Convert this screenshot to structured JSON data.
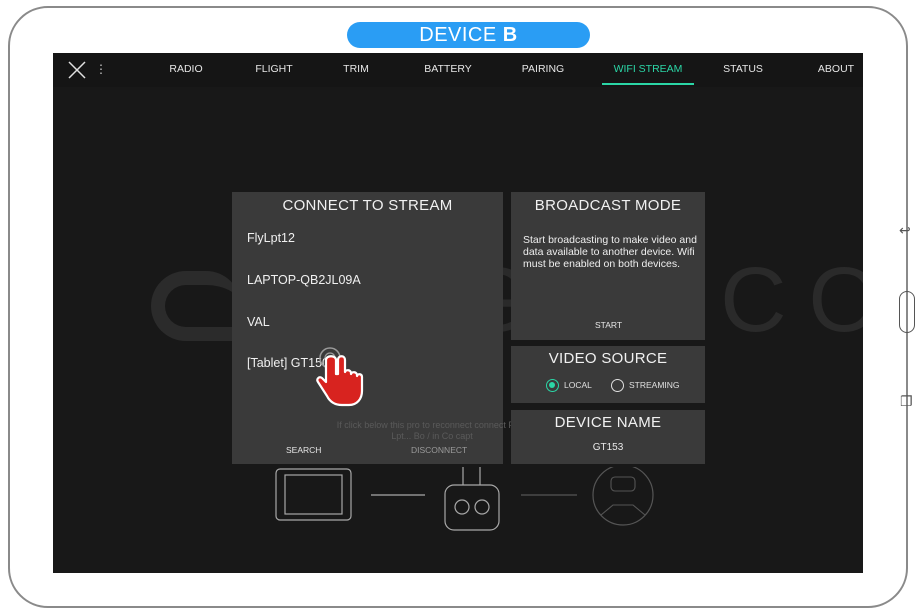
{
  "device_label": {
    "prefix": "DEVICE",
    "letter": "B"
  },
  "colors": {
    "accent": "#2bd6a6",
    "label_bg": "#2a9df4",
    "panel": "#3a3a3a",
    "screen_bg": "#181818"
  },
  "nav": {
    "menu_icon": "⋮",
    "tabs": [
      {
        "label": "RADIO",
        "active": false
      },
      {
        "label": "FLIGHT",
        "active": false
      },
      {
        "label": "TRIM",
        "active": false
      },
      {
        "label": "BATTERY",
        "active": false
      },
      {
        "label": "PAIRING",
        "active": false
      },
      {
        "label": "WIFI STREAM",
        "active": true
      },
      {
        "label": "STATUS",
        "active": false
      },
      {
        "label": "ABOUT",
        "active": false
      }
    ]
  },
  "watermark": "FLIGHTCOCKPIT",
  "connect": {
    "title": "CONNECT TO STREAM",
    "networks": [
      "FlyLpt12",
      "LAPTOP-QB2JL09A",
      "VAL",
      "[Tablet] GT150"
    ],
    "search_label": "SEARCH",
    "disconnect_label": "DISCONNECT",
    "overlay_message": "If click below this pro to reconnect connect Fly... Lpt... Bo / in Co capt"
  },
  "broadcast": {
    "title": "BROADCAST MODE",
    "description": "Start broadcasting to make video and data available to another device. Wifi must be enabled on both devices.",
    "start_label": "START"
  },
  "video_source": {
    "title": "VIDEO SOURCE",
    "options": [
      {
        "label": "LOCAL",
        "selected": true
      },
      {
        "label": "STREAMING",
        "selected": false
      }
    ]
  },
  "device_name": {
    "title": "DEVICE NAME",
    "value": "GT153"
  },
  "icons": {
    "close": "close-icon",
    "menu": "menu-dots-icon",
    "back": "back-icon",
    "recents": "recents-icon",
    "pointer": "hand-pointer-icon",
    "tablet": "tablet-icon",
    "controller": "remote-controller-icon",
    "drone": "drone-icon"
  },
  "side_glyphs": {
    "back": "↩",
    "recents": "❐"
  }
}
